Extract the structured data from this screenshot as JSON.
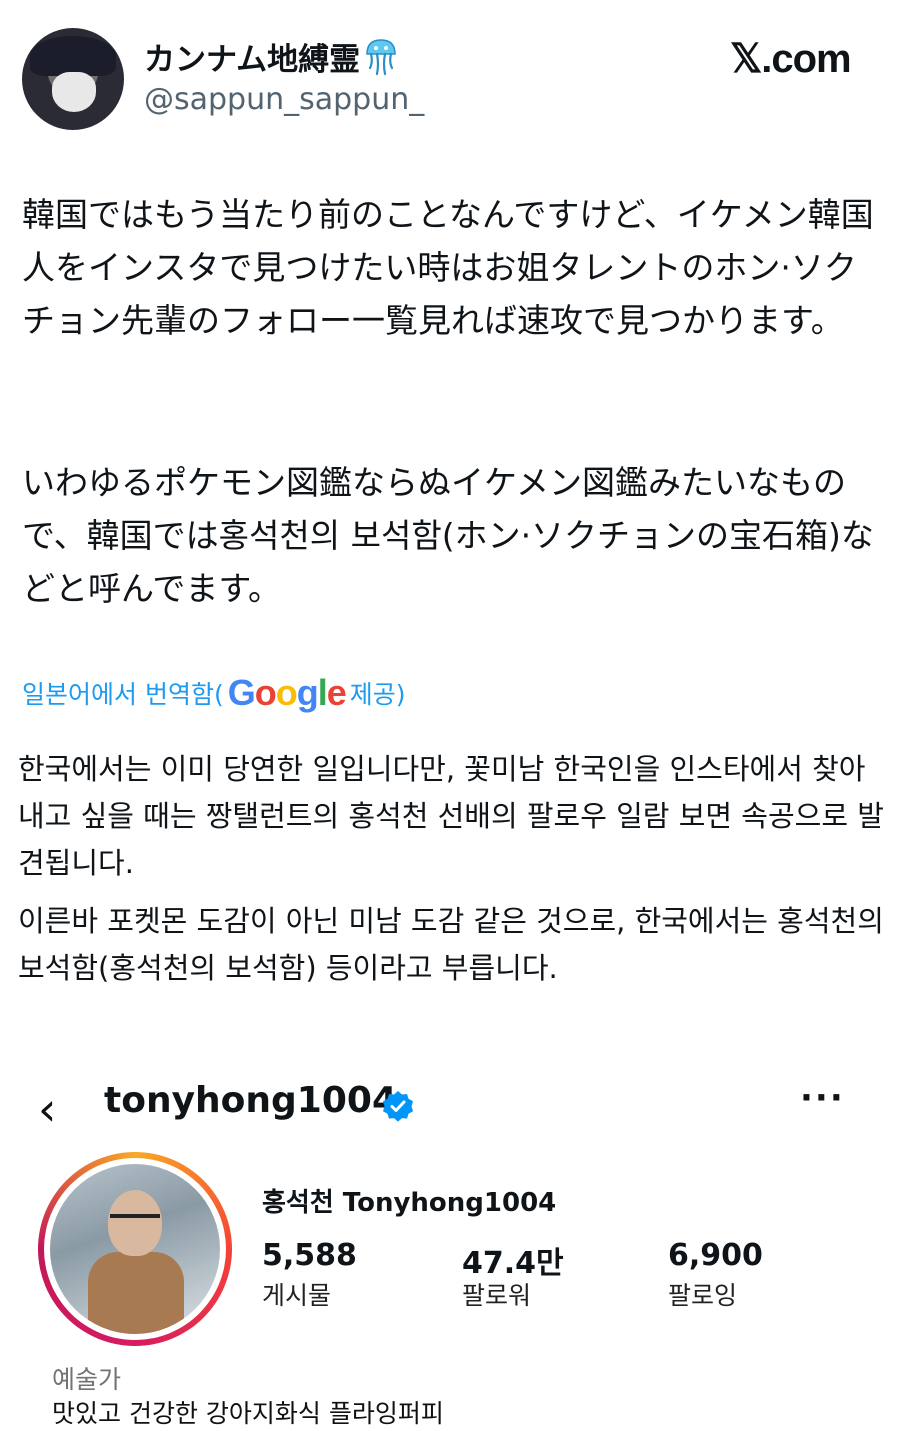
{
  "tweet": {
    "display_name": "カンナム地縛霊",
    "handle": "@sappun_sappun_",
    "site": "𝕏.com",
    "paragraph_1": "韓国ではもう当たり前のことなんですけど、イケメン韓国人をインスタで見つけたい時はお姐タレントのホン·ソクチョン先輩のフォロー一覧見れば速攻で見つかります。",
    "paragraph_2": "いわゆるポケモン図鑑ならぬイケメン図鑑みたいなもので、韓国では홍석천의 보석함(ホン·ソクチョンの宝石箱)などと呼んでます。",
    "translated_prefix": "일본어에서 번역함(",
    "translated_suffix": "제공)",
    "translation_1": "한국에서는 이미 당연한 일입니다만, 꽃미남 한국인을 인스타에서 찾아내고 싶을 때는 짱탤런트의 홍석천 선배의 팔로우 일람 보면 속공으로 발견됩니다.",
    "translation_2": "이른바 포켓몬 도감이 아닌 미남 도감 같은 것으로, 한국에서는 홍석천의 보석함(홍석천의 보석함) 등이라고 부릅니다."
  },
  "google_logo": [
    "G",
    "o",
    "o",
    "g",
    "l",
    "e"
  ],
  "instagram": {
    "back_icon": "‹",
    "username": "tonyhong1004",
    "more_icon": "···",
    "full_name": "홍석천 Tonyhong1004",
    "stats": [
      {
        "value": "5,588",
        "label": "게시물"
      },
      {
        "value": "47.4만",
        "label": "팔로워"
      },
      {
        "value": "6,900",
        "label": "팔로잉"
      }
    ],
    "category": "예술가",
    "bio": "맛있고 건강한 강아지화식 플라잉퍼피"
  },
  "colors": {
    "link": "#1d9bf0",
    "verified": "#0095f6",
    "secondary_text": "#536471"
  }
}
